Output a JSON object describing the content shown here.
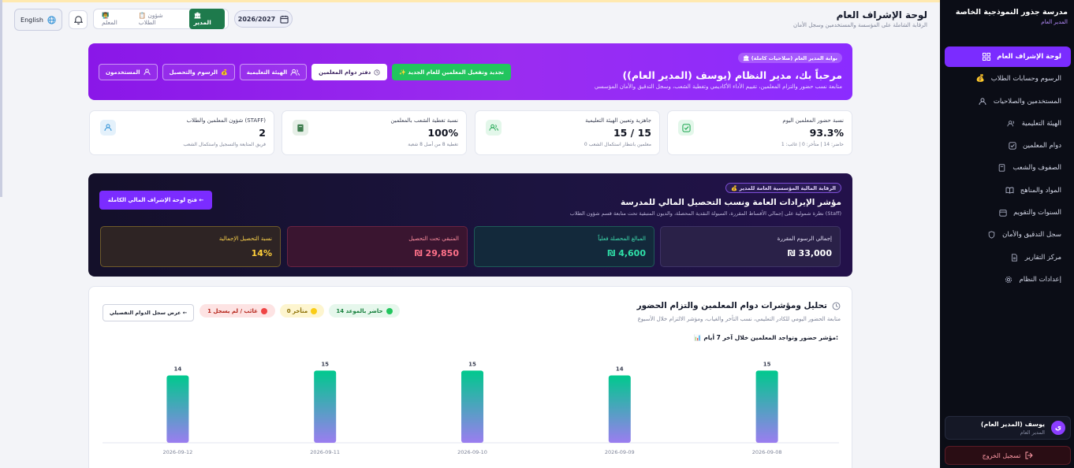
{
  "header": {
    "title": "لوحة الإشراف العام",
    "subtitle": "الرقابة الشاملة على المؤسسة والمستخدمين وسجل الأمان",
    "academic_year": "2026/2027",
    "role_switch": {
      "admin": "المدير",
      "student_affairs": "شؤون الطلاب",
      "teacher": "المعلم"
    },
    "language_button": "English"
  },
  "sidebar": {
    "school_name": "مدرسة جذور النموذجية الخاصة",
    "role_label": "المدير العام",
    "items": [
      {
        "label": "لوحة الإشراف العام",
        "icon": "grid-icon",
        "active": true
      },
      {
        "label": "الرسوم وحسابات الطلاب",
        "icon": "money-bag-icon"
      },
      {
        "label": "المستخدمين والصلاحيات",
        "icon": "user-icon"
      },
      {
        "label": "الهيئة التعليمية",
        "icon": "users-icon"
      },
      {
        "label": "دوام المعلمين",
        "icon": "check-square-icon"
      },
      {
        "label": "الصفوف والشعب",
        "icon": "book-icon"
      },
      {
        "label": "المواد والمناهج",
        "icon": "open-book-icon"
      },
      {
        "label": "السنوات والتقويم",
        "icon": "calendar-icon"
      },
      {
        "label": "سجل التدقيق والأمان",
        "icon": "shield-icon"
      },
      {
        "label": "مركز التقارير",
        "icon": "file-icon"
      },
      {
        "label": "إعدادات النظام",
        "icon": "gear-icon"
      }
    ],
    "user": {
      "name": "يوسف (المدير العام)",
      "role": "المدير العام",
      "initial": "ي"
    },
    "logout": "تسجيل الخروج"
  },
  "hero": {
    "badge": "بوابة المدير العام (صلاحيات كاملة)",
    "title": "مرحباً بك، مدير النظام (يوسف (المدير العام))",
    "subtitle": "متابعة نسب حضور والتزام المعلمين، تقييم الأداء الأكاديمي وتغطية الشعب، وسجل التدقيق والأمان المؤسسي",
    "actions": [
      {
        "label": "✨ تجديد وتفعيل المعلمين للعام الجديد",
        "style": "green"
      },
      {
        "label": "دفتر دوام المعلمين",
        "style": "white"
      },
      {
        "label": "الهيئة التعليمية",
        "style": "outline"
      },
      {
        "label": "الرسوم والتحصيل",
        "style": "outline"
      },
      {
        "label": "المستخدمون",
        "style": "outline"
      }
    ]
  },
  "stats": [
    {
      "title": "نسبة حضور المعلمين اليوم",
      "value": "93.3%",
      "sub": "حاضر: 14 | متأخر: 0 | غائب: 1",
      "icon": "check-square-icon",
      "color": "#16a34a",
      "bg": "#e3f7ea"
    },
    {
      "title": "جاهزية وتعيين الهيئة التعليمية",
      "value": "15 / 15",
      "sub": "0 معلمين بانتظار استكمال الشعب",
      "icon": "users-icon",
      "color": "#16a34a",
      "bg": "#e3f7ea"
    },
    {
      "title": "نسبة تغطية الشعب بالمعلمين",
      "value": "100%",
      "sub": "تغطية 8 من أصل 8 شعبة",
      "icon": "book-icon",
      "color": "#3f7d4f",
      "bg": "#e6efe7"
    },
    {
      "title": "شؤون المعلمين والطلاب (STAFF)",
      "value": "2",
      "sub": "فريق المتابعة والتسجيل واستكمال الشعب",
      "icon": "user-icon",
      "color": "#2b8fd6",
      "bg": "#e4f1fb"
    }
  ],
  "finance": {
    "badge": "الرقابة المالية المؤسسية العامة للمدير",
    "title": "مؤشر الإيرادات العامة ونسب التحصيل المالي للمدرسة",
    "subtitle": "نظرة شمولية على إجمالي الأقساط المقررة، السيولة النقدية المحصلة، والديون المتبقية تحت متابعة قسم شؤون الطلاب (Staff)",
    "button": "فتح لوحة الإشراف المالي الكاملة ←",
    "cards": [
      {
        "label": "إجمالي الرسوم المقررة",
        "value": "₪ 33,000",
        "label_color": "#e8e4f8",
        "value_color": "#ffffff",
        "bg": "#2a2148",
        "border": "#3e3366"
      },
      {
        "label": "المبالغ المحصلة فعلياً",
        "value": "₪ 4,600",
        "label_color": "#3fe0b0",
        "value_color": "#2fe0a8",
        "bg": "#13293b",
        "border": "#1e5a58"
      },
      {
        "label": "المتبقي تحت التحصيل",
        "value": "₪ 29,850",
        "label_color": "#ff8fa0",
        "value_color": "#ff7189",
        "bg": "#3a1530",
        "border": "#6a2342"
      },
      {
        "label": "نسبة التحصيل الإجمالية",
        "value": "14%",
        "label_color": "#ffd54d",
        "value_color": "#ffcf3a",
        "bg": "#2e2424",
        "border": "#6e5a2a"
      }
    ]
  },
  "attendance": {
    "title": "تحليل ومؤشرات دوام المعلمين والتزام الحضور",
    "subtitle": "متابعة الحضور اليومي للكادر التعليمي، نسب التأخر والغياب، ومؤشر الالتزام خلال الأسبوع",
    "pills": [
      {
        "label": "14 حاضر بالموعد",
        "dot": "#22c55e",
        "bg": "#e6f7ec",
        "color": "#17803d"
      },
      {
        "label": "0 متأخر",
        "dot": "#facc15",
        "bg": "#fdf5cf",
        "color": "#8a6d00"
      },
      {
        "label": "1 غائب / لم يسجل",
        "dot": "#ef4444",
        "bg": "#fde3e3",
        "color": "#b42318"
      }
    ],
    "detail_button": "عرض سجل الدوام التفصيلي ←",
    "chart_label": "📊 مؤشر حضور وتواجد المعلمين خلال آخر 7 أيام:"
  },
  "chart_data": {
    "type": "bar",
    "categories": [
      "2026-09-08",
      "2026-09-09",
      "2026-09-10",
      "2026-09-11",
      "2026-09-12"
    ],
    "values": [
      15,
      14,
      15,
      15,
      14
    ],
    "ylim": [
      0,
      17
    ],
    "grid": false,
    "gradient": [
      "#00c98d",
      "#9b7df0"
    ]
  }
}
